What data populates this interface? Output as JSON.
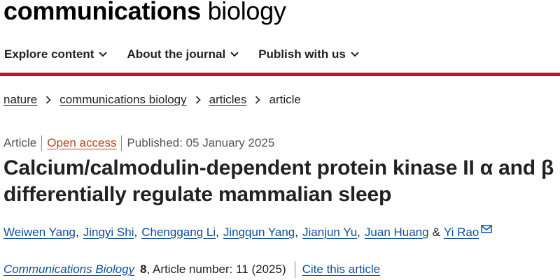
{
  "logo": {
    "bold": "communications",
    "light": "biology"
  },
  "nav": [
    {
      "label": "Explore content"
    },
    {
      "label": "About the journal"
    },
    {
      "label": "Publish with us"
    }
  ],
  "colors": {
    "accent_bar": "#c8102e",
    "link": "#0a4f9e",
    "open_access": "#b5461a"
  },
  "breadcrumb": [
    "nature",
    "communications biology",
    "articles",
    "article"
  ],
  "meta": {
    "type": "Article",
    "access": "Open access",
    "published": "Published: 05 January 2025"
  },
  "title": "Calcium/calmodulin-dependent protein kinase II α and β differentially regulate mammalian sleep",
  "authors": [
    "Weiwen Yang",
    "Jingyi Shi",
    "Chenggang Li",
    "Jingqun Yang",
    "Jianjun Yu",
    "Juan Huang",
    "Yi Rao"
  ],
  "authors_amp": "&",
  "journal": {
    "name": "Communications Biology",
    "volume": "8",
    "article": ", Article number: 11 (2025)",
    "cite": "Cite this article"
  }
}
